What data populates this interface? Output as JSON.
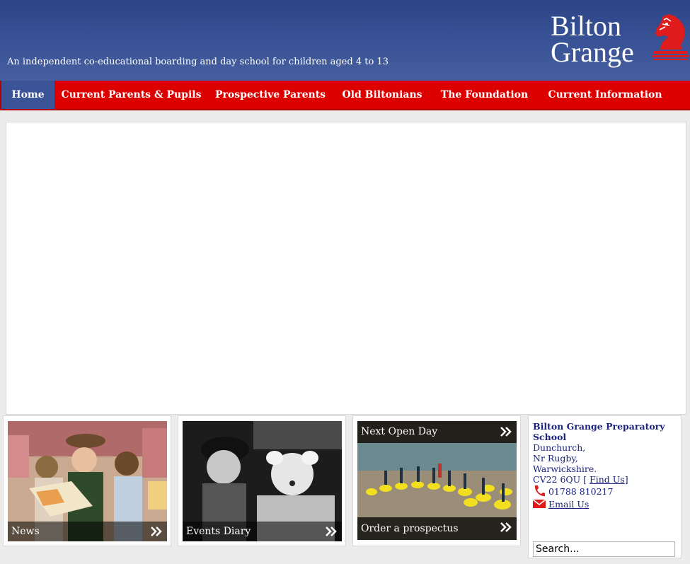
{
  "header": {
    "tagline": "An independent co-educational boarding and day school for children aged 4 to 13",
    "logo_line1": "Bilton",
    "logo_line2": "Grange",
    "logo_icon": "knight-horse-icon"
  },
  "nav": {
    "items": [
      {
        "label": "Home"
      },
      {
        "label": "Current Parents & Pupils"
      },
      {
        "label": "Prospective Parents"
      },
      {
        "label": "Old Biltonians"
      },
      {
        "label": "The Foundation"
      },
      {
        "label": "Current Information"
      }
    ]
  },
  "cards": {
    "news": {
      "label": "News",
      "icon": "double-arrow-icon"
    },
    "events": {
      "label": "Events Diary",
      "icon": "double-arrow-icon"
    },
    "open_day": {
      "top_label": "Next Open Day",
      "bottom_label": "Order a prospectus",
      "icon": "double-arrow-icon"
    }
  },
  "contact": {
    "name": "Bilton Grange Preparatory School",
    "address1": "Dunchurch,",
    "address2": "Nr Rugby,",
    "address3": "Warwickshire.",
    "postcode": "CV22 6QU [",
    "find_us": "Find Us",
    "find_us_close": "]",
    "phone": "01788 810217",
    "email_label": "Email Us",
    "search_placeholder": "Search..."
  },
  "colors": {
    "header_blue": "#3a5497",
    "nav_red": "#dd0000",
    "text_navy": "#1a237e"
  }
}
